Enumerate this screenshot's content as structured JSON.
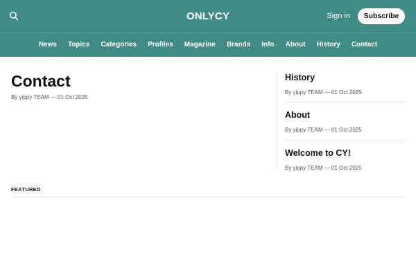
{
  "header": {
    "brand": "ONLYCY",
    "sign_in": "Sign in",
    "subscribe": "Subscribe",
    "search_icon": "search-icon",
    "background_color": "#3f8c86"
  },
  "nav": {
    "items": [
      "News",
      "Topics",
      "Categories",
      "Profiles",
      "Magazine",
      "Brands",
      "Info",
      "About",
      "History",
      "Contact"
    ]
  },
  "main": {
    "title": "Contact",
    "meta": "By yippy TEAM — 01 Oct 2025"
  },
  "sidebar": {
    "posts": [
      {
        "title": "History",
        "meta": "By yippy TEAM — 01 Oct 2025"
      },
      {
        "title": "About",
        "meta": "By yippy TEAM — 01 Oct 2025"
      },
      {
        "title": "Welcome to CY!",
        "meta": "By yippy TEAM — 01 Oct 2025"
      }
    ]
  },
  "featured": {
    "label": "FEATURED"
  }
}
